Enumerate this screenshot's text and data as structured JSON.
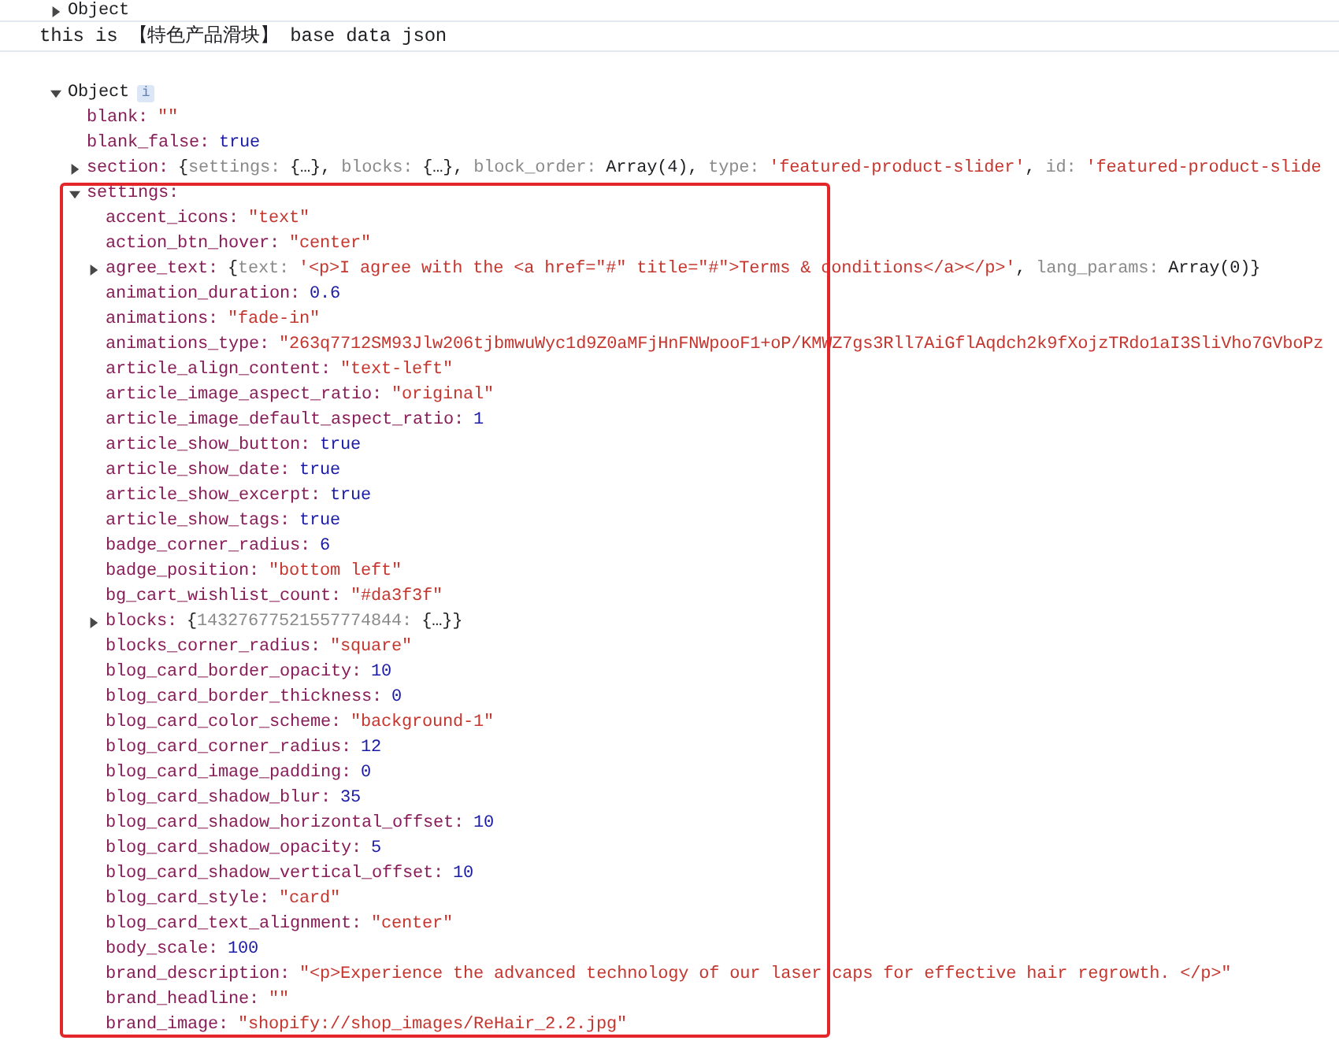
{
  "console": {
    "previous_entry": {
      "label": "Object",
      "expanded": false
    },
    "log_message": "this is 【特色产品滑块】 base data json",
    "object": {
      "label": "Object",
      "info_badge": "i",
      "expanded": true,
      "children": [
        {
          "key": "blank:",
          "kind": "string",
          "value": "\"\""
        },
        {
          "key": "blank_false:",
          "kind": "boolean",
          "value": "true"
        },
        {
          "key": "section:",
          "kind": "object",
          "expanded": false,
          "preview": [
            {
              "kind": "punct",
              "text": "{"
            },
            {
              "kind": "key",
              "text": "settings:"
            },
            {
              "kind": "punct",
              "text": "{…}, "
            },
            {
              "kind": "key",
              "text": "blocks:"
            },
            {
              "kind": "punct",
              "text": "{…}, "
            },
            {
              "kind": "key",
              "text": "block_order:"
            },
            {
              "kind": "punct",
              "text": "Array(4), "
            },
            {
              "kind": "key",
              "text": "type:"
            },
            {
              "kind": "string",
              "text": "'featured-product-slider'"
            },
            {
              "kind": "punct",
              "text": ", "
            },
            {
              "kind": "key",
              "text": "id:"
            },
            {
              "kind": "string",
              "text": "'featured-product-slide"
            }
          ]
        },
        {
          "key": "settings:",
          "kind": "object",
          "expanded": true,
          "children": [
            {
              "key": "accent_icons:",
              "kind": "string",
              "value": "\"text\""
            },
            {
              "key": "action_btn_hover:",
              "kind": "string",
              "value": "\"center\""
            },
            {
              "key": "agree_text:",
              "kind": "object",
              "expanded": false,
              "preview": [
                {
                  "kind": "punct",
                  "text": "{"
                },
                {
                  "kind": "key",
                  "text": "text:"
                },
                {
                  "kind": "string",
                  "text": "'<p>I agree with the <a href=\"#\" title=\"#\">Terms & conditions</a></p>'"
                },
                {
                  "kind": "punct",
                  "text": ", "
                },
                {
                  "kind": "key",
                  "text": "lang_params:"
                },
                {
                  "kind": "punct",
                  "text": "Array(0)}"
                }
              ]
            },
            {
              "key": "animation_duration:",
              "kind": "number",
              "value": "0.6"
            },
            {
              "key": "animations:",
              "kind": "string",
              "value": "\"fade-in\""
            },
            {
              "key": "animations_type:",
              "kind": "string",
              "value": "\"263q7712SM93Jlw206tjbmwuWyc1d9Z0aMFjHnFNWpooF1+oP/KMWZ7gs3Rll7AiGflAqdch2k9fXojzTRdo1aI3SliVho7GVboPz"
            },
            {
              "key": "article_align_content:",
              "kind": "string",
              "value": "\"text-left\""
            },
            {
              "key": "article_image_aspect_ratio:",
              "kind": "string",
              "value": "\"original\""
            },
            {
              "key": "article_image_default_aspect_ratio:",
              "kind": "number",
              "value": "1"
            },
            {
              "key": "article_show_button:",
              "kind": "boolean",
              "value": "true"
            },
            {
              "key": "article_show_date:",
              "kind": "boolean",
              "value": "true"
            },
            {
              "key": "article_show_excerpt:",
              "kind": "boolean",
              "value": "true"
            },
            {
              "key": "article_show_tags:",
              "kind": "boolean",
              "value": "true"
            },
            {
              "key": "badge_corner_radius:",
              "kind": "number",
              "value": "6"
            },
            {
              "key": "badge_position:",
              "kind": "string",
              "value": "\"bottom left\""
            },
            {
              "key": "bg_cart_wishlist_count:",
              "kind": "string",
              "value": "\"#da3f3f\""
            },
            {
              "key": "blocks:",
              "kind": "object",
              "expanded": false,
              "preview": [
                {
                  "kind": "punct",
                  "text": "{"
                },
                {
                  "kind": "key",
                  "text": "14327677521557774844:"
                },
                {
                  "kind": "punct",
                  "text": "{…}}"
                }
              ]
            },
            {
              "key": "blocks_corner_radius:",
              "kind": "string",
              "value": "\"square\""
            },
            {
              "key": "blog_card_border_opacity:",
              "kind": "number",
              "value": "10"
            },
            {
              "key": "blog_card_border_thickness:",
              "kind": "number",
              "value": "0"
            },
            {
              "key": "blog_card_color_scheme:",
              "kind": "string",
              "value": "\"background-1\""
            },
            {
              "key": "blog_card_corner_radius:",
              "kind": "number",
              "value": "12"
            },
            {
              "key": "blog_card_image_padding:",
              "kind": "number",
              "value": "0"
            },
            {
              "key": "blog_card_shadow_blur:",
              "kind": "number",
              "value": "35"
            },
            {
              "key": "blog_card_shadow_horizontal_offset:",
              "kind": "number",
              "value": "10"
            },
            {
              "key": "blog_card_shadow_opacity:",
              "kind": "number",
              "value": "5"
            },
            {
              "key": "blog_card_shadow_vertical_offset:",
              "kind": "number",
              "value": "10"
            },
            {
              "key": "blog_card_style:",
              "kind": "string",
              "value": "\"card\""
            },
            {
              "key": "blog_card_text_alignment:",
              "kind": "string",
              "value": "\"center\""
            },
            {
              "key": "body_scale:",
              "kind": "number",
              "value": "100"
            },
            {
              "key": "brand_description:",
              "kind": "string",
              "value": "\"<p>Experience the advanced technology of our laser caps for effective hair regrowth. </p>\""
            },
            {
              "key": "brand_headline:",
              "kind": "string",
              "value": "\"\""
            },
            {
              "key": "brand_image:",
              "kind": "string",
              "value": "\"shopify://shop_images/ReHair_2.2.jpg\""
            }
          ]
        }
      ]
    }
  }
}
